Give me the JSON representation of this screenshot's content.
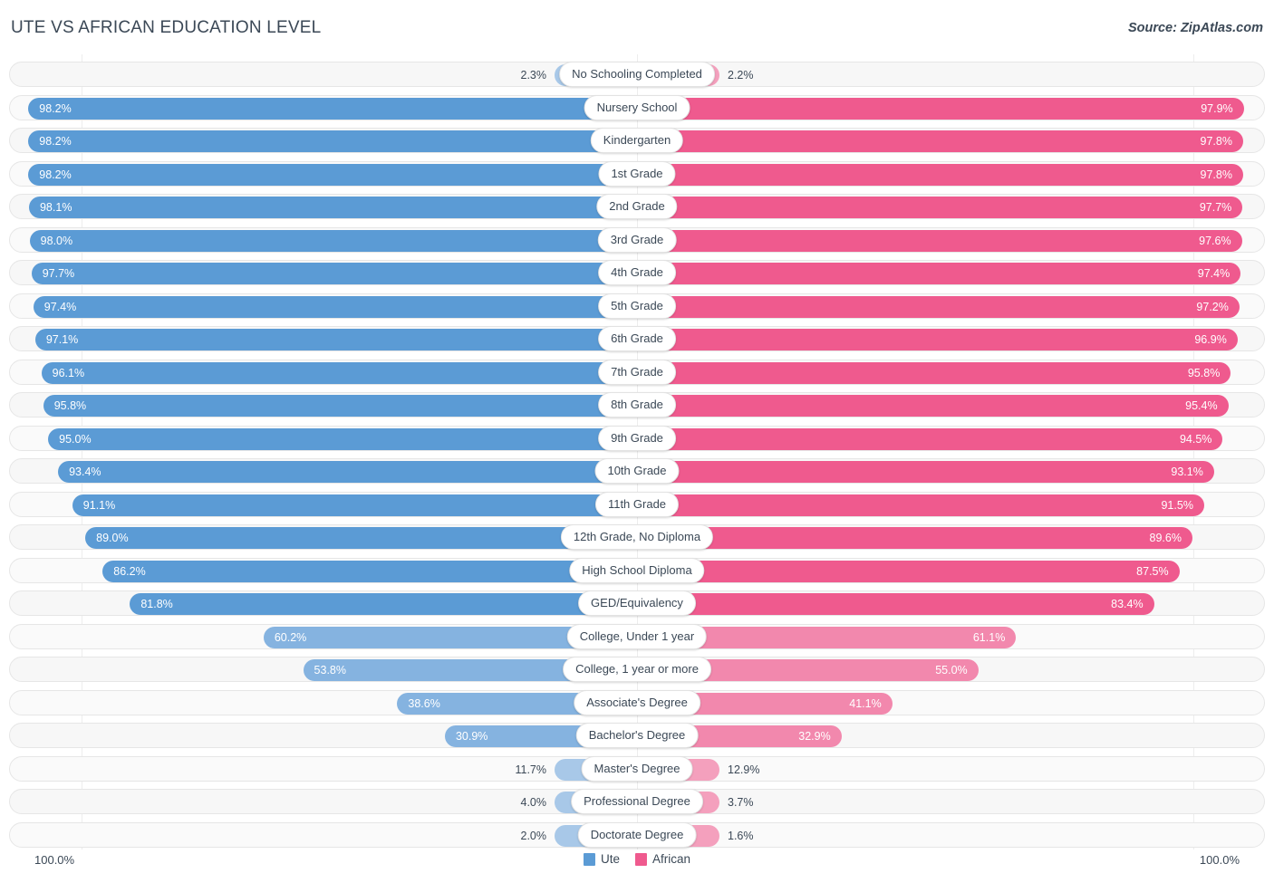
{
  "header": {
    "title": "UTE VS AFRICAN EDUCATION LEVEL",
    "source": "Source: ZipAtlas.com"
  },
  "footer": {
    "axis_left": "100.0%",
    "axis_right": "100.0%",
    "legend": [
      {
        "label": "Ute",
        "color": "#5b9bd5"
      },
      {
        "label": "African",
        "color": "#ef5a8e"
      }
    ]
  },
  "colors": {
    "blue_strong": "#5b9bd5",
    "blue_mid": "#85b3e0",
    "blue_light": "#a8c8e8",
    "pink_strong": "#ef5a8e",
    "pink_mid": "#f288ad",
    "pink_light": "#f4a0bd",
    "track": "#f7f7f7",
    "text": "#3b4856"
  },
  "chart_data": {
    "type": "bar",
    "title": "UTE VS AFRICAN EDUCATION LEVEL",
    "subtitle": "",
    "xlabel": "",
    "ylabel": "",
    "orientation": "horizontal-diverging",
    "axis_max": 100.0,
    "grid": true,
    "legend_position": "bottom-center",
    "series": [
      {
        "name": "Ute",
        "color": "#5b9bd5",
        "values": [
          2.3,
          98.2,
          98.2,
          98.2,
          98.1,
          98.0,
          97.7,
          97.4,
          97.1,
          96.1,
          95.8,
          95.0,
          93.4,
          91.1,
          89.0,
          86.2,
          81.8,
          60.2,
          53.8,
          38.6,
          30.9,
          11.7,
          4.0,
          2.0
        ]
      },
      {
        "name": "African",
        "color": "#ef5a8e",
        "values": [
          2.2,
          97.9,
          97.8,
          97.8,
          97.7,
          97.6,
          97.4,
          97.2,
          96.9,
          95.8,
          95.4,
          94.5,
          93.1,
          91.5,
          89.6,
          87.5,
          83.4,
          61.1,
          55.0,
          41.1,
          32.9,
          12.9,
          3.7,
          1.6
        ]
      }
    ],
    "categories": [
      "No Schooling Completed",
      "Nursery School",
      "Kindergarten",
      "1st Grade",
      "2nd Grade",
      "3rd Grade",
      "4th Grade",
      "5th Grade",
      "6th Grade",
      "7th Grade",
      "8th Grade",
      "9th Grade",
      "10th Grade",
      "11th Grade",
      "12th Grade, No Diploma",
      "High School Diploma",
      "GED/Equivalency",
      "College, Under 1 year",
      "College, 1 year or more",
      "Associate's Degree",
      "Bachelor's Degree",
      "Master's Degree",
      "Professional Degree",
      "Doctorate Degree"
    ]
  },
  "rows": [
    {
      "label": "No Schooling Completed",
      "left": "2.3%",
      "right": "2.2%",
      "lv": 2.3,
      "rv": 2.2
    },
    {
      "label": "Nursery School",
      "left": "98.2%",
      "right": "97.9%",
      "lv": 98.2,
      "rv": 97.9
    },
    {
      "label": "Kindergarten",
      "left": "98.2%",
      "right": "97.8%",
      "lv": 98.2,
      "rv": 97.8
    },
    {
      "label": "1st Grade",
      "left": "98.2%",
      "right": "97.8%",
      "lv": 98.2,
      "rv": 97.8
    },
    {
      "label": "2nd Grade",
      "left": "98.1%",
      "right": "97.7%",
      "lv": 98.1,
      "rv": 97.7
    },
    {
      "label": "3rd Grade",
      "left": "98.0%",
      "right": "97.6%",
      "lv": 98.0,
      "rv": 97.6
    },
    {
      "label": "4th Grade",
      "left": "97.7%",
      "right": "97.4%",
      "lv": 97.7,
      "rv": 97.4
    },
    {
      "label": "5th Grade",
      "left": "97.4%",
      "right": "97.2%",
      "lv": 97.4,
      "rv": 97.2
    },
    {
      "label": "6th Grade",
      "left": "97.1%",
      "right": "96.9%",
      "lv": 97.1,
      "rv": 96.9
    },
    {
      "label": "7th Grade",
      "left": "96.1%",
      "right": "95.8%",
      "lv": 96.1,
      "rv": 95.8
    },
    {
      "label": "8th Grade",
      "left": "95.8%",
      "right": "95.4%",
      "lv": 95.8,
      "rv": 95.4
    },
    {
      "label": "9th Grade",
      "left": "95.0%",
      "right": "94.5%",
      "lv": 95.0,
      "rv": 94.5
    },
    {
      "label": "10th Grade",
      "left": "93.4%",
      "right": "93.1%",
      "lv": 93.4,
      "rv": 93.1
    },
    {
      "label": "11th Grade",
      "left": "91.1%",
      "right": "91.5%",
      "lv": 91.1,
      "rv": 91.5
    },
    {
      "label": "12th Grade, No Diploma",
      "left": "89.0%",
      "right": "89.6%",
      "lv": 89.0,
      "rv": 89.6
    },
    {
      "label": "High School Diploma",
      "left": "86.2%",
      "right": "87.5%",
      "lv": 86.2,
      "rv": 87.5
    },
    {
      "label": "GED/Equivalency",
      "left": "81.8%",
      "right": "83.4%",
      "lv": 81.8,
      "rv": 83.4
    },
    {
      "label": "College, Under 1 year",
      "left": "60.2%",
      "right": "61.1%",
      "lv": 60.2,
      "rv": 61.1
    },
    {
      "label": "College, 1 year or more",
      "left": "53.8%",
      "right": "55.0%",
      "lv": 53.8,
      "rv": 55.0
    },
    {
      "label": "Associate's Degree",
      "left": "38.6%",
      "right": "41.1%",
      "lv": 38.6,
      "rv": 41.1
    },
    {
      "label": "Bachelor's Degree",
      "left": "30.9%",
      "right": "32.9%",
      "lv": 30.9,
      "rv": 32.9
    },
    {
      "label": "Master's Degree",
      "left": "11.7%",
      "right": "12.9%",
      "lv": 11.7,
      "rv": 12.9
    },
    {
      "label": "Professional Degree",
      "left": "4.0%",
      "right": "3.7%",
      "lv": 4.0,
      "rv": 3.7
    },
    {
      "label": "Doctorate Degree",
      "left": "2.0%",
      "right": "1.6%",
      "lv": 2.0,
      "rv": 1.6
    }
  ]
}
